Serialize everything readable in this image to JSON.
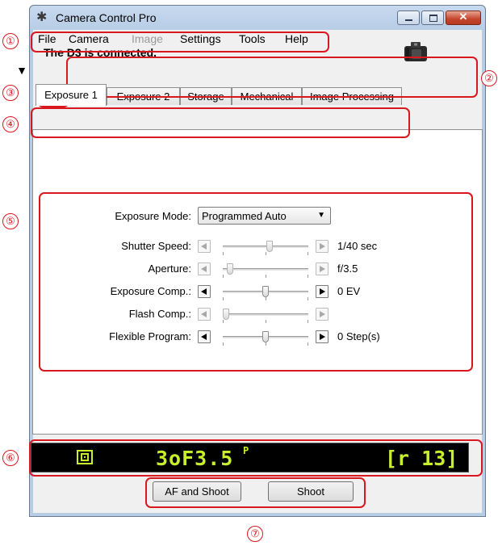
{
  "window": {
    "title": "Camera Control Pro"
  },
  "menu": [
    "File",
    "Camera",
    "Image",
    "Settings",
    "Tools",
    "Help"
  ],
  "menu_disabled": [
    "Image"
  ],
  "status": {
    "text": "The D3 is connected.",
    "collapse_glyph": "▼"
  },
  "tabs": [
    "Exposure 1",
    "Exposure 2",
    "Storage",
    "Mechanical",
    "Image Processing"
  ],
  "active_tab": "Exposure 1",
  "controls": {
    "exposure_mode": {
      "label": "Exposure Mode:",
      "value": "Programmed Auto",
      "arrow": "▼"
    },
    "rows": [
      {
        "label": "Shutter Speed:",
        "value": "1/40 sec",
        "enabled": false,
        "slider_fraction": 0.55
      },
      {
        "label": "Aperture:",
        "value": "f/3.5",
        "enabled": false,
        "slider_fraction": 0.05
      },
      {
        "label": "Exposure Comp.:",
        "value": "0 EV",
        "enabled": true,
        "slider_fraction": 0.5
      },
      {
        "label": "Flash Comp.:",
        "value": "",
        "enabled": false,
        "slider_fraction": 0.0
      },
      {
        "label": "Flexible Program:",
        "value": "0 Step(s)",
        "enabled": true,
        "slider_fraction": 0.5
      }
    ]
  },
  "lcd": {
    "main": "3oF3.5",
    "mode": "P",
    "right": "[r 13]"
  },
  "buttons": {
    "af_shoot": "AF and Shoot",
    "shoot": "Shoot"
  },
  "callouts": [
    "①",
    "②",
    "③",
    "④",
    "⑤",
    "⑥",
    "⑦"
  ],
  "colors": {
    "callout": "#d8171e",
    "lcd_text": "#c8ef2b"
  }
}
